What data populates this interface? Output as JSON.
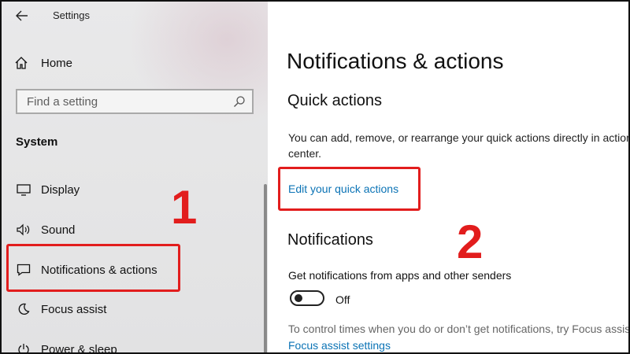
{
  "window": {
    "title": "Settings"
  },
  "sidebar": {
    "home_label": "Home",
    "search_placeholder": "Find a setting",
    "section_label": "System",
    "items": [
      {
        "label": "Display",
        "icon": "monitor-icon"
      },
      {
        "label": "Sound",
        "icon": "speaker-icon"
      },
      {
        "label": "Notifications & actions",
        "icon": "message-icon",
        "selected": true
      },
      {
        "label": "Focus assist",
        "icon": "moon-icon"
      },
      {
        "label": "Power & sleep",
        "icon": "power-icon"
      }
    ]
  },
  "main": {
    "page_title": "Notifications & actions",
    "quick_actions": {
      "heading": "Quick actions",
      "description": "You can add, remove, or rearrange your quick actions directly in action center.",
      "edit_link": "Edit your quick actions"
    },
    "notifications": {
      "heading": "Notifications",
      "get_notifications_label": "Get notifications from apps and other senders",
      "toggle_state": "Off",
      "control_times_text": "To control times when you do or don’t get notifications, try Focus assist.",
      "focus_assist_link": "Focus assist settings"
    }
  },
  "annotations": {
    "marker_1": "1",
    "marker_2": "2",
    "color": "#e21d1d"
  },
  "colors": {
    "link": "#0b73b5",
    "sidebar_bg": "#e6e6e7"
  }
}
